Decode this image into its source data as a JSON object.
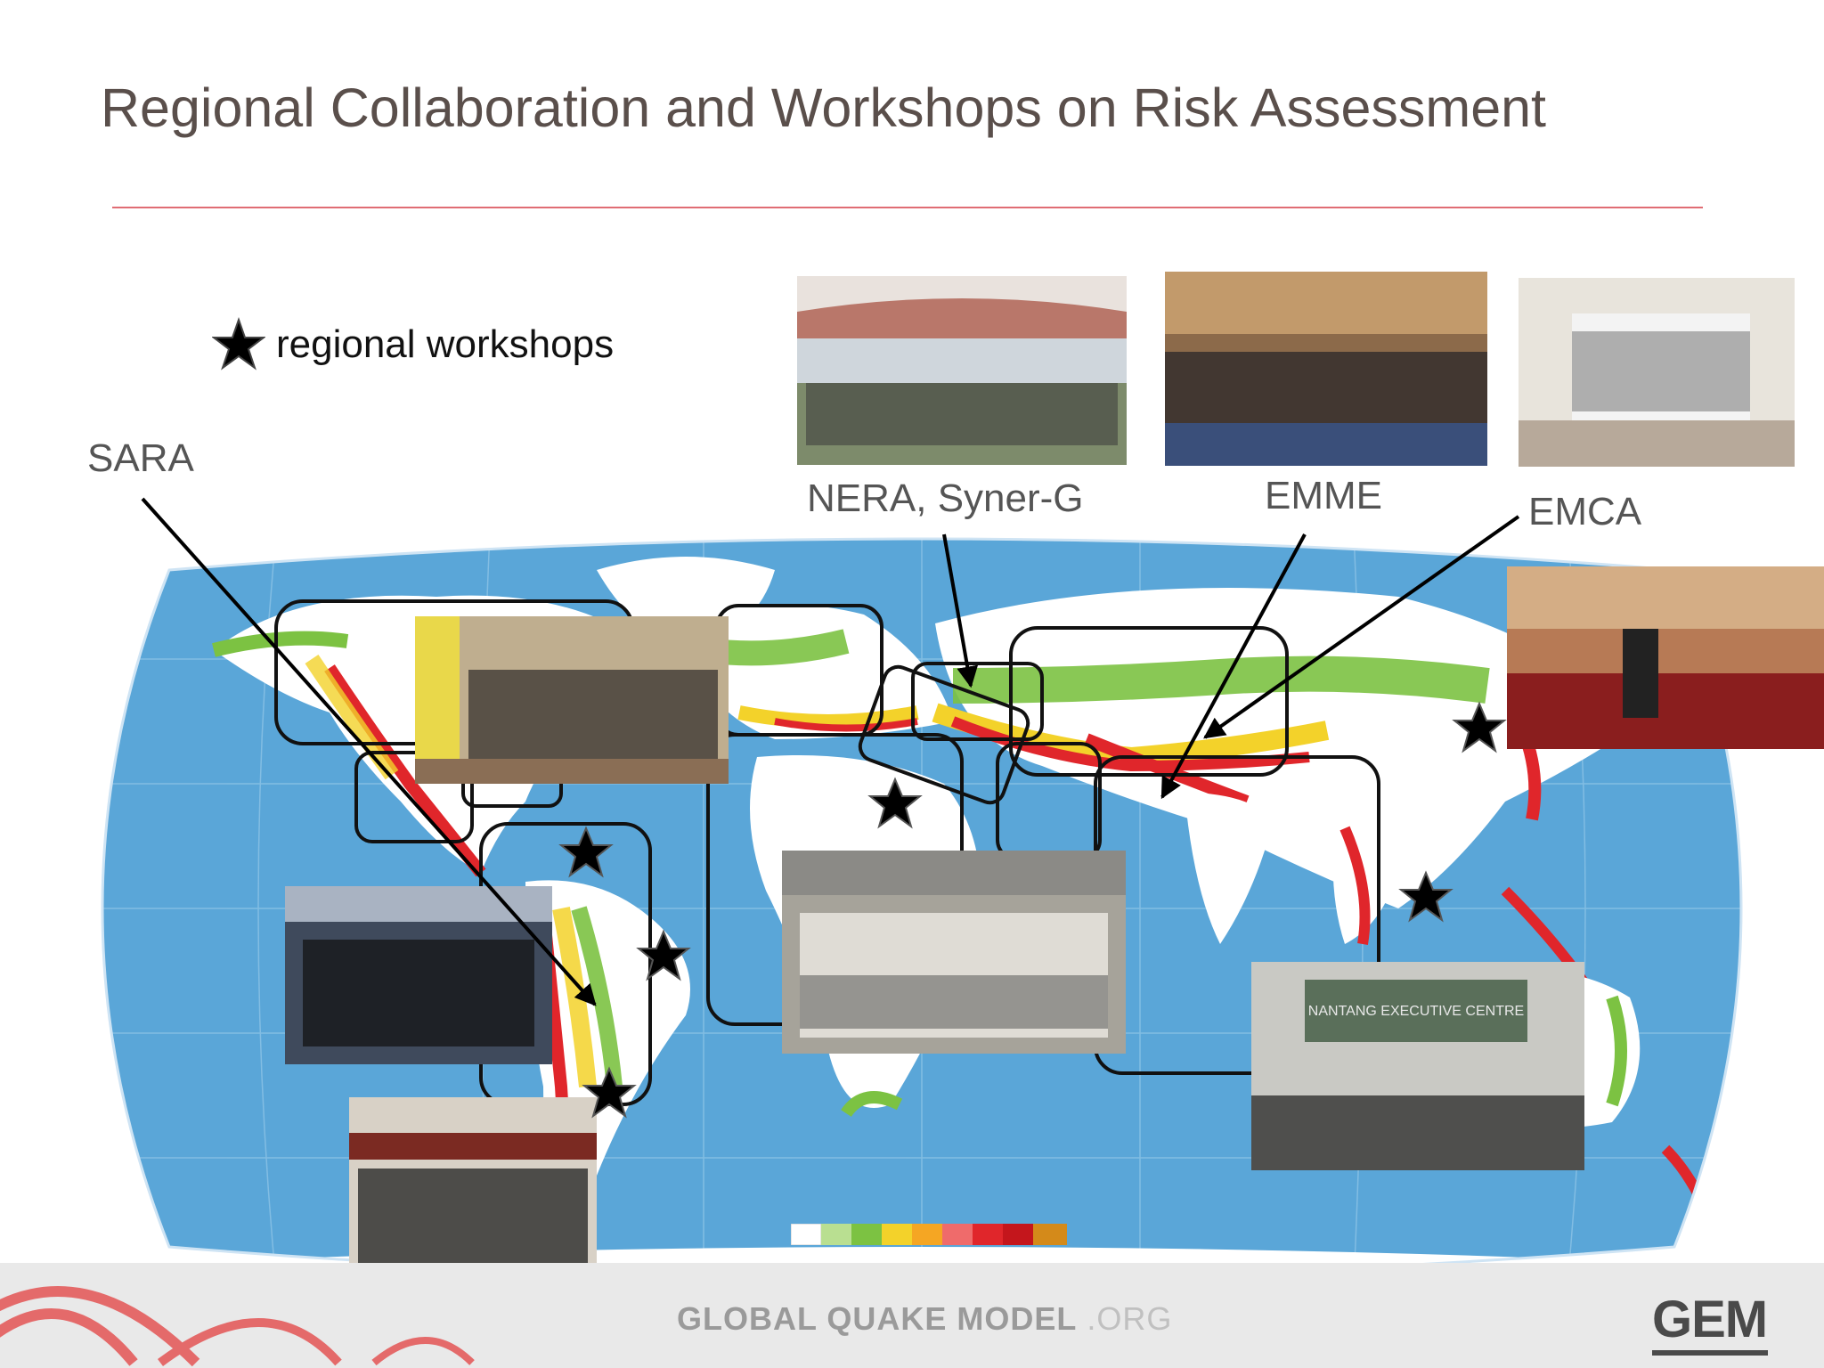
{
  "slide": {
    "title": "Regional Collaboration and Workshops on Risk Assessment",
    "legend_label": "regional workshops",
    "labels": {
      "sara": "SARA",
      "nera": "NERA, Syner-G",
      "emme": "EMME",
      "emca": "EMCA"
    },
    "photo_sign_text": "NANTANG EXECUTIVE CENTRE",
    "footer": {
      "site_main": "GLOBAL QUAKE MODEL",
      "site_suffix": " .ORG",
      "logo": "GEM"
    }
  },
  "colors": {
    "title": "#5a4f4b",
    "rule": "#e06d74",
    "ocean": "#5aa6d8",
    "land": "#ffffff",
    "hazard_green": "#7cc242",
    "hazard_yellow": "#f3d22a",
    "hazard_red": "#e0262b",
    "box_stroke": "#111111",
    "footer_arc": "#e46a6a"
  },
  "legend_scale_colors": [
    "#ffffff",
    "#b9df91",
    "#7cc242",
    "#f3d22a",
    "#f5a623",
    "#ef6b6b",
    "#e0262b",
    "#c4161c",
    "#d48a1a"
  ],
  "icons": {
    "legend": "star-icon"
  }
}
